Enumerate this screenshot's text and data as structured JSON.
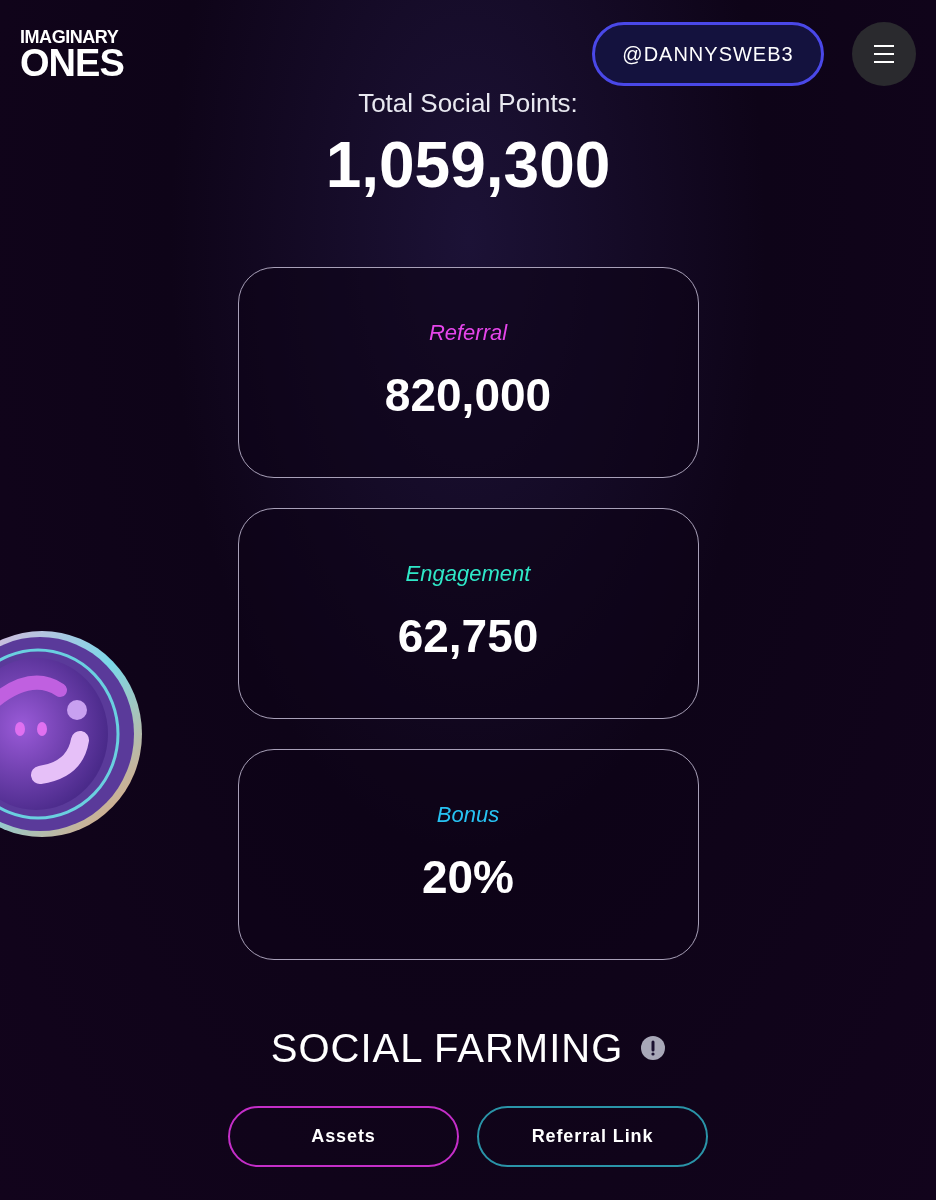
{
  "logo": {
    "line_1": "IMAGINARY",
    "line_2": "ONES"
  },
  "user_button": "@DANNYSWEB3",
  "total": {
    "label": "Total Social Points:",
    "value": "1,059,300"
  },
  "cards": [
    {
      "label": "Referral",
      "value": "820,000",
      "color": "#e545ea"
    },
    {
      "label": "Engagement",
      "value": "62,750",
      "color": "#2fe8c8"
    },
    {
      "label": "Bonus",
      "value": "20%",
      "color": "#27c2f2"
    }
  ],
  "section": {
    "title": "SOCIAL FARMING"
  },
  "buttons": [
    {
      "label": "Assets",
      "color": "#c42ec8"
    },
    {
      "label": "Referral Link",
      "color": "#2a94a8"
    }
  ]
}
